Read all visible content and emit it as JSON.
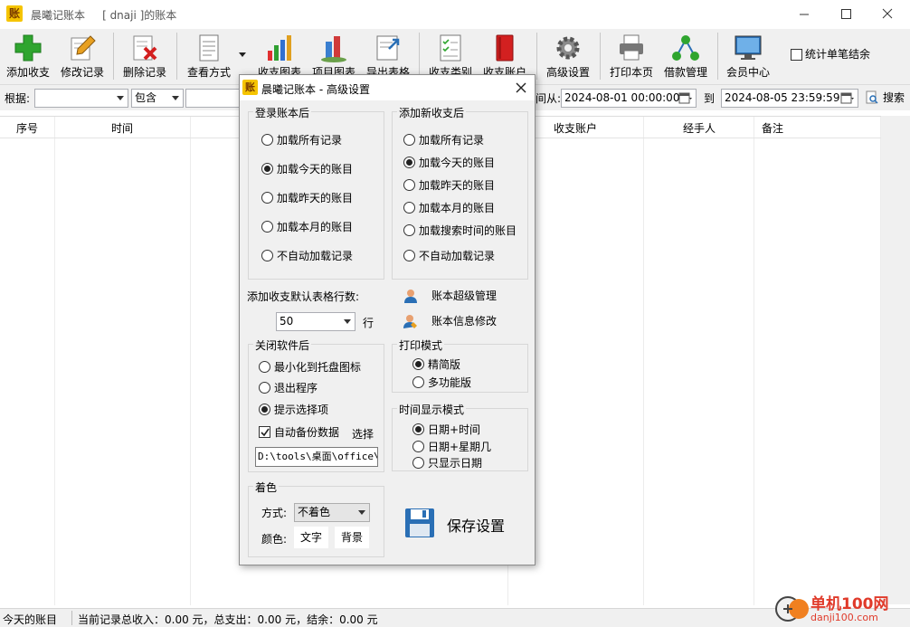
{
  "window": {
    "app_icon_char": "账",
    "title": "晨曦记账本     [ dnaji ]的账本"
  },
  "toolbar": {
    "add": "添加收支",
    "edit": "修改记录",
    "delete": "删除记录",
    "view_mode": "查看方式",
    "chart_income": "收支图表",
    "chart_items": "项目图表",
    "export": "导出表格",
    "category": "收支类别",
    "account": "收支账户",
    "advanced": "高级设置",
    "print": "打印本页",
    "loan": "借款管理",
    "member": "会员中心",
    "stat_checkbox": "统计单笔结余"
  },
  "filter": {
    "basis_label": "根据:",
    "basis_value": "",
    "match_value": "包含",
    "time_from_label": "时间从:",
    "time_from": "2024-08-01 00:00:00",
    "to_label": "到",
    "time_to": "2024-08-05 23:59:59",
    "search_label": "搜索"
  },
  "grid": {
    "columns": [
      "序号",
      "时间",
      "收支账户",
      "经手人",
      "备注"
    ]
  },
  "status": {
    "left": "今天的账目",
    "summary": "当前记录总收入：0.00 元，总支出：0.00 元，结余：0.00 元"
  },
  "dialog": {
    "icon_char": "账",
    "title": "晨曦记账本 - 高级设置",
    "login_group": "登录账本后",
    "login_options": [
      "加载所有记录",
      "加载今天的账目",
      "加载昨天的账目",
      "加载本月的账目",
      "不自动加载记录"
    ],
    "login_selected": 1,
    "add_group": "添加新收支后",
    "add_options": [
      "加载所有记录",
      "加载今天的账目",
      "加载昨天的账目",
      "加载本月的账目",
      "加载搜索时间的账目",
      "不自动加载记录"
    ],
    "add_selected": 1,
    "rows_label": "添加收支默认表格行数:",
    "rows_value": "50",
    "rows_unit": "行",
    "super_admin": "账本超级管理",
    "info_edit": "账本信息修改",
    "close_group": "关闭软件后",
    "close_options": [
      "最小化到托盘图标",
      "退出程序",
      "提示选择项"
    ],
    "close_selected": 2,
    "auto_backup": "自动备份数据",
    "backup_checked": true,
    "choose": "选择",
    "backup_path": "D:\\tools\\桌面\\office\\E",
    "print_group": "打印模式",
    "print_options": [
      "精简版",
      "多功能版"
    ],
    "print_selected": 0,
    "time_group": "时间显示模式",
    "time_options": [
      "日期+时间",
      "日期+星期几",
      "只显示日期"
    ],
    "time_selected": 0,
    "color_group": "着色",
    "mode_label": "方式:",
    "mode_value": "不着色",
    "color_label": "颜色:",
    "text_btn": "文字",
    "bg_btn": "背景",
    "save": "保存设置"
  },
  "watermark": {
    "line1": "单机100网",
    "line2": "danji100.com"
  },
  "colors": {
    "accent_green": "#2fa52f",
    "delete_red": "#d32020",
    "save_blue": "#2a6fb5"
  }
}
